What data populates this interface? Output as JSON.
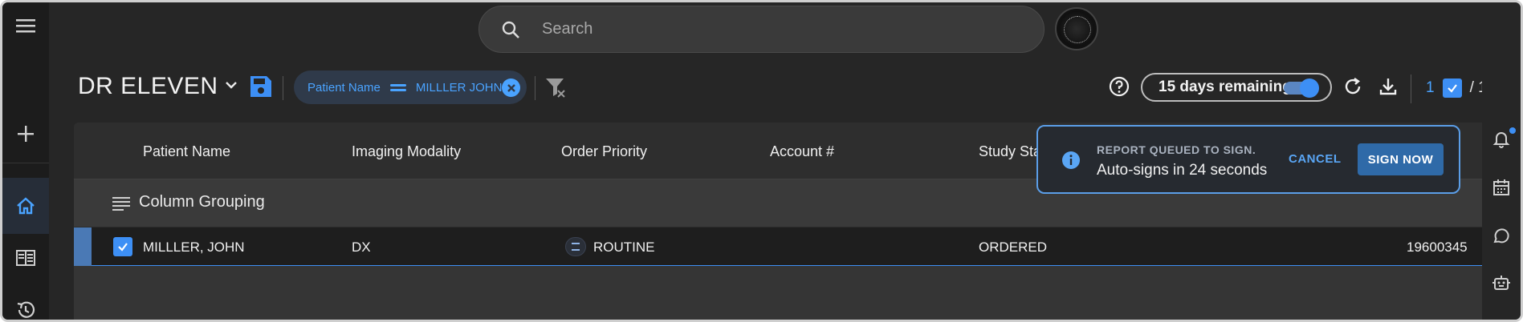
{
  "search": {
    "placeholder": "Search"
  },
  "toolbar": {
    "title": "DR ELEVEN",
    "filter_chip": {
      "field": "Patient Name",
      "value": "MILLLER JOHN"
    },
    "days_remaining": "15 days remaining",
    "selected_count": "1",
    "total_count": "/ 1"
  },
  "grid": {
    "columns": [
      "Patient Name",
      "Imaging Modality",
      "Order Priority",
      "Account #",
      "Study Sta"
    ],
    "grouping_label": "Column Grouping",
    "rows": [
      {
        "patient_name": "MILLLER, JOHN",
        "modality": "DX",
        "priority": "ROUTINE",
        "account": "",
        "study_status": "ORDERED",
        "id": "19600345"
      }
    ]
  },
  "toast": {
    "title": "REPORT QUEUED TO SIGN.",
    "message": "Auto-signs in 24 seconds",
    "cancel_label": "CANCEL",
    "sign_label": "SIGN NOW"
  },
  "colors": {
    "accent": "#3d8ff5",
    "background": "#262626",
    "rail": "#1c1c1c"
  },
  "icons": {
    "left_rail": [
      "menu-icon",
      "add-icon",
      "home-icon",
      "worklist-icon",
      "history-icon"
    ],
    "right_rail": [
      "bell-icon",
      "calendar-icon",
      "chat-icon",
      "bot-icon"
    ]
  }
}
